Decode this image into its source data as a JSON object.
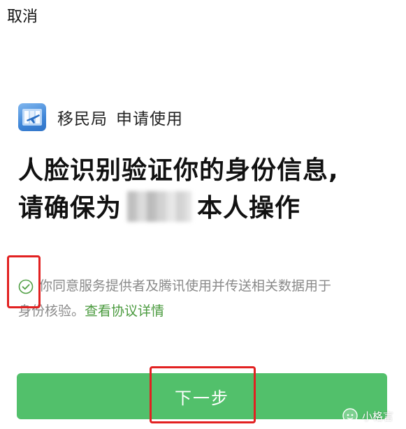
{
  "header": {
    "cancel_label": "取消"
  },
  "app": {
    "name": "移民局",
    "action": "申请使用",
    "icon": "immigration-app-icon",
    "icon_color": "#3f86d8"
  },
  "headline": {
    "line1": "人脸识别验证你的身份信息,",
    "line2_prefix": "请确保为",
    "line2_suffix": "本人操作"
  },
  "consent": {
    "checked": true,
    "text_line1": "你同意服务提供者及腾讯使用并传送相关数据用于",
    "text_line2": "身份核验。",
    "link_label": "查看协议详情",
    "link_color": "#4a9a3e",
    "check_color": "#52a046"
  },
  "primary_button": {
    "label": "下一步",
    "color": "#52c06b"
  },
  "annotations": {
    "highlight_color": "#e22121"
  },
  "watermark": {
    "text": "小格言",
    "icon": "wechat-official-account-icon"
  }
}
